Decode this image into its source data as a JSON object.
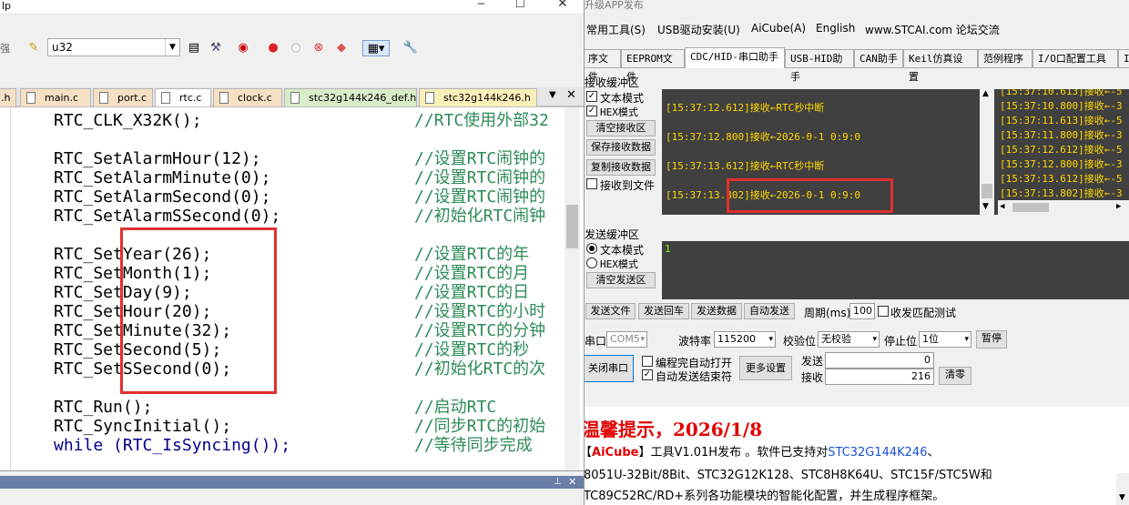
{
  "ide": {
    "menu_fragment": "lp",
    "toolbar_left_fragment": "强",
    "target_combo": "u32",
    "tabs": [
      {
        "label": ".h"
      },
      {
        "label": "main.c"
      },
      {
        "label": "port.c"
      },
      {
        "label": "rtc.c"
      },
      {
        "label": "clock.c"
      },
      {
        "label": "stc32g144k246_def.h"
      },
      {
        "label": "stc32g144k246.h"
      }
    ],
    "code": [
      {
        "code": "RTC_CLK_X32K();",
        "comment": "//RTC使用外部32"
      },
      {
        "code": "RTC_SetAlarmHour(12);",
        "comment": "//设置RTC闹钟的"
      },
      {
        "code": "RTC_SetAlarmMinute(0);",
        "comment": "//设置RTC闹钟的"
      },
      {
        "code": "RTC_SetAlarmSecond(0);",
        "comment": "//设置RTC闹钟的"
      },
      {
        "code": "RTC_SetAlarmSSecond(0);",
        "comment": "//初始化RTC闹钟"
      },
      {
        "code": "RTC_SetYear(26);",
        "comment": "//设置RTC的年"
      },
      {
        "code": "RTC_SetMonth(1);",
        "comment": "//设置RTC的月"
      },
      {
        "code": "RTC_SetDay(9);",
        "comment": "//设置RTC的日"
      },
      {
        "code": "RTC_SetHour(20);",
        "comment": "//设置RTC的小时"
      },
      {
        "code": "RTC_SetMinute(32);",
        "comment": "//设置RTC的分钟"
      },
      {
        "code": "RTC_SetSecond(5);",
        "comment": "//设置RTC的秒"
      },
      {
        "code": "RTC_SetSSecond(0);",
        "comment": "//初始化RTC的次"
      },
      {
        "code": "RTC_Run();",
        "comment": "//启动RTC"
      },
      {
        "code": "RTC_SyncInitial();",
        "comment": "//同步RTC的初始"
      },
      {
        "code": "while (RTC_IsSyncing());",
        "comment": "//等待同步完成"
      }
    ]
  },
  "isp": {
    "title_fragment": "升级APP发布",
    "menu": [
      "常用工具(S)",
      "USB驱动安装(U)",
      "AiCube(A)",
      "English",
      "www.STCAI.com 论坛交流"
    ],
    "tabs": [
      "序文件",
      "EEPROM文件",
      "CDC/HID-串口助手",
      "USB-HID助手",
      "CAN助手",
      "Keil仿真设置",
      "范例程序",
      "I/O口配置工具",
      "I"
    ],
    "recv_section": "接收缓冲区",
    "recv_text_mode": "文本模式",
    "recv_hex_mode": "HEX模式",
    "clear_recv": "清空接收区",
    "save_recv": "保存接收数据",
    "copy_recv": "复制接收数据",
    "recv_to_file": "接收到文件",
    "recv_lines": [
      "[15:37:12.612]接收←RTC秒中断",
      "[15:37:12.800]接收←2026-0-1 0:9:0",
      "[15:37:13.612]接收←RTC秒中断",
      "[15:37:13.802]接收←2026-0-1 0:9:0"
    ],
    "hex_lines": [
      "[15:37:10.613]接收←-5",
      "[15:37:10.800]接收←-3",
      "[15:37:11.613]接收←-5",
      "[15:37:11.800]接收←-3",
      "[15:37:12.612]接收←-5",
      "[15:37:12.800]接收←-3",
      "[15:37:13.612]接收←-5",
      "[15:37:13.802]接收←-3"
    ],
    "send_section": "发送缓冲区",
    "send_text_mode": "文本模式",
    "send_hex_mode": "HEX模式",
    "clear_send": "清空发送区",
    "send_content": "1",
    "send_file": "发送文件",
    "send_return": "发送回车",
    "send_data": "发送数据",
    "auto_send": "自动发送",
    "period_label": "周期(ms)",
    "period_value": "100",
    "match_test": "收发匹配测试",
    "port_label": "串口",
    "port_value": "COM5",
    "baud_label": "波特率",
    "baud_value": "115200",
    "parity_label": "校验位",
    "parity_value": "无校验",
    "stop_label": "停止位",
    "stop_value": "1位",
    "pause": "暂停",
    "close_port": "关闭串口",
    "auto_open": "编程完自动打开",
    "auto_close": "自动发送结束符",
    "more_settings": "更多设置",
    "sent_label": "发送",
    "sent_value": "0",
    "recv_label": "接收",
    "recv_value": "216",
    "clear_count": "清零",
    "notice_title": "温馨提示，2026/1/8",
    "notice_line1_a": "【",
    "notice_line1_brand": "AiCube",
    "notice_line1_b": "】工具V1.01H发布 。软件已支持对",
    "notice_line1_link": "STC32G144K246",
    "notice_line1_c": "、",
    "notice_line2": "8051U-32Bit/8Bit、STC32G12K128、STC8H8K64U、STC15F/STC5W和",
    "notice_line3": "TC89C52RC/RD+系列各功能模块的智能化配置，并生成程序框架。"
  },
  "colors": {
    "highlight_box": "#e03030",
    "recv_bg": "#404040",
    "recv_text": "#ffd700",
    "notice_red": "#e00000"
  }
}
